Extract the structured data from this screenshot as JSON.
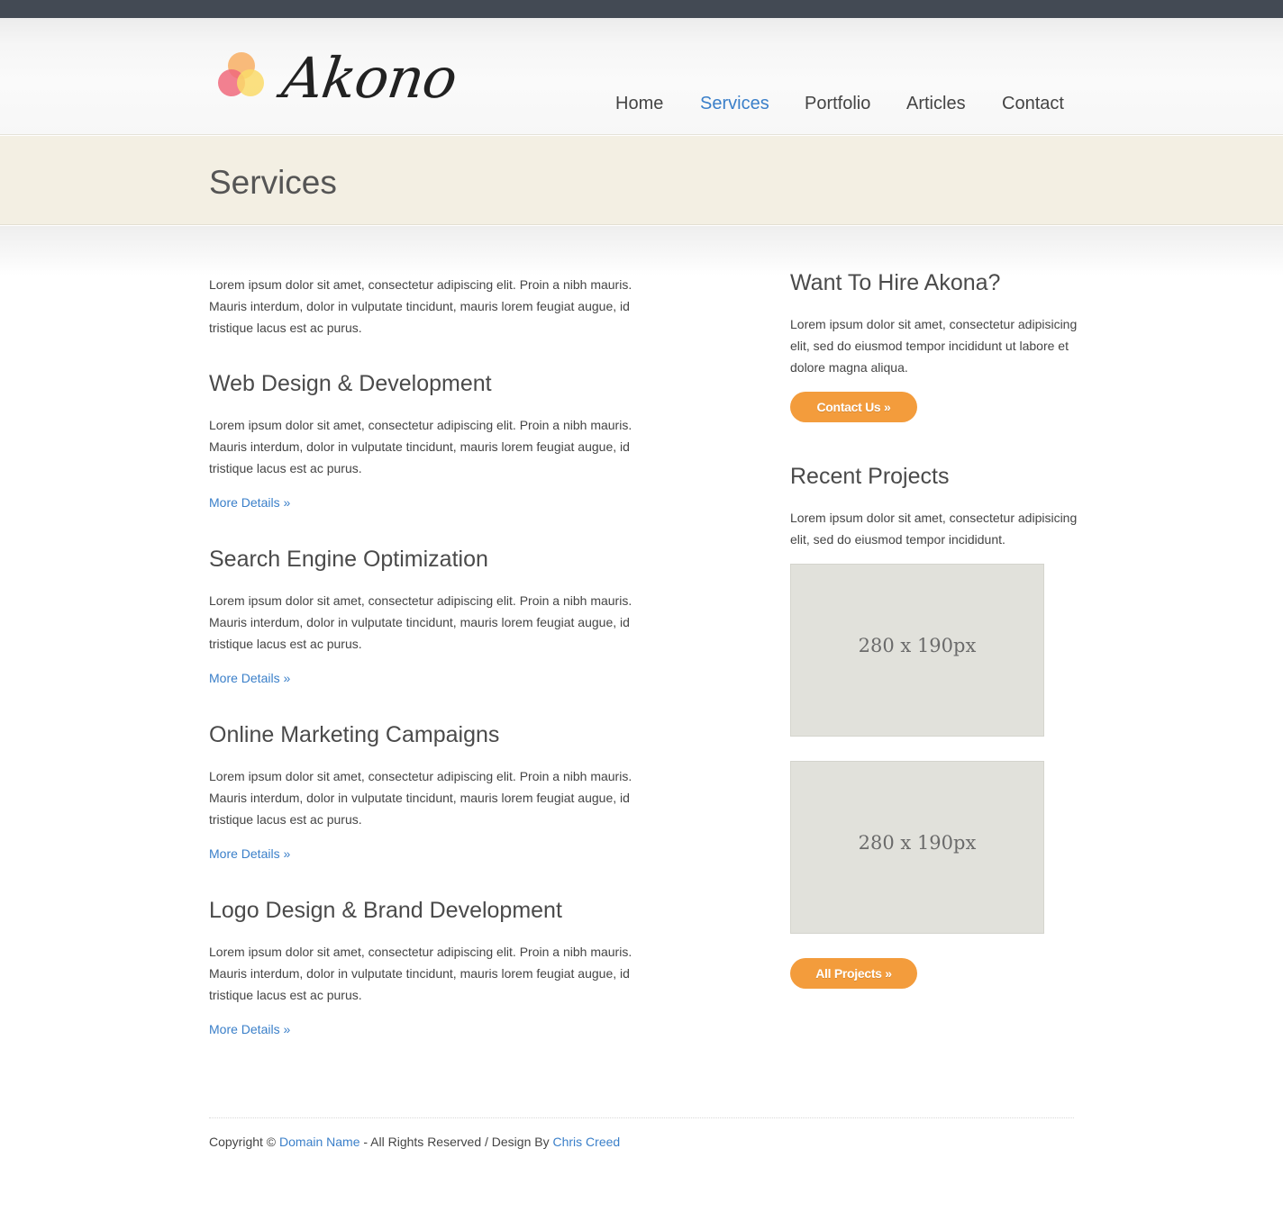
{
  "site": {
    "logo_text": "Akono",
    "logo_colors": [
      "#f7b36b",
      "#f06a7c",
      "#fadb6a"
    ]
  },
  "nav": {
    "items": [
      {
        "label": "Home",
        "active": false
      },
      {
        "label": "Services",
        "active": true
      },
      {
        "label": "Portfolio",
        "active": false
      },
      {
        "label": "Articles",
        "active": false
      },
      {
        "label": "Contact",
        "active": false
      }
    ]
  },
  "banner": {
    "title": "Services"
  },
  "main": {
    "intro": "Lorem ipsum dolor sit amet, consectetur adipiscing elit. Proin a nibh mauris. Mauris interdum, dolor in vulputate tincidunt, mauris lorem feugiat augue, id tristique lacus est ac purus.",
    "sections": [
      {
        "title": "Web Design & Development",
        "text": "Lorem ipsum dolor sit amet, consectetur adipiscing elit. Proin a nibh mauris. Mauris interdum, dolor in vulputate tincidunt, mauris lorem feugiat augue, id tristique lacus est ac purus.",
        "link": "More Details »"
      },
      {
        "title": "Search Engine Optimization",
        "text": "Lorem ipsum dolor sit amet, consectetur adipiscing elit. Proin a nibh mauris. Mauris interdum, dolor in vulputate tincidunt, mauris lorem feugiat augue, id tristique lacus est ac purus.",
        "link": "More Details »"
      },
      {
        "title": "Online Marketing Campaigns",
        "text": "Lorem ipsum dolor sit amet, consectetur adipiscing elit. Proin a nibh mauris. Mauris interdum, dolor in vulputate tincidunt, mauris lorem feugiat augue, id tristique lacus est ac purus.",
        "link": "More Details »"
      },
      {
        "title": "Logo Design & Brand Development",
        "text": "Lorem ipsum dolor sit amet, consectetur adipiscing elit. Proin a nibh mauris. Mauris interdum, dolor in vulputate tincidunt, mauris lorem feugiat augue, id tristique lacus est ac purus.",
        "link": "More Details »"
      }
    ]
  },
  "sidebar": {
    "hire": {
      "title": "Want To Hire Akona?",
      "text": "Lorem ipsum dolor sit amet, consectetur adipisicing elit, sed do eiusmod tempor incididunt ut labore et dolore magna aliqua.",
      "button": "Contact Us »"
    },
    "projects": {
      "title": "Recent Projects",
      "text": "Lorem ipsum dolor sit amet, consectetur adipisicing elit, sed do eiusmod tempor incididunt.",
      "placeholders": [
        "280 x 190px",
        "280 x 190px"
      ],
      "button": "All Projects »"
    }
  },
  "footer": {
    "prefix": "Copyright © ",
    "domain_link": "Domain Name",
    "middle": " - All Rights Reserved / Design By ",
    "designer_link": "Chris Creed"
  },
  "colors": {
    "accent_blue": "#3a7fc9",
    "button_orange": "#f39c3c",
    "banner_bg": "#f3efe3",
    "topbar": "#434a54"
  }
}
